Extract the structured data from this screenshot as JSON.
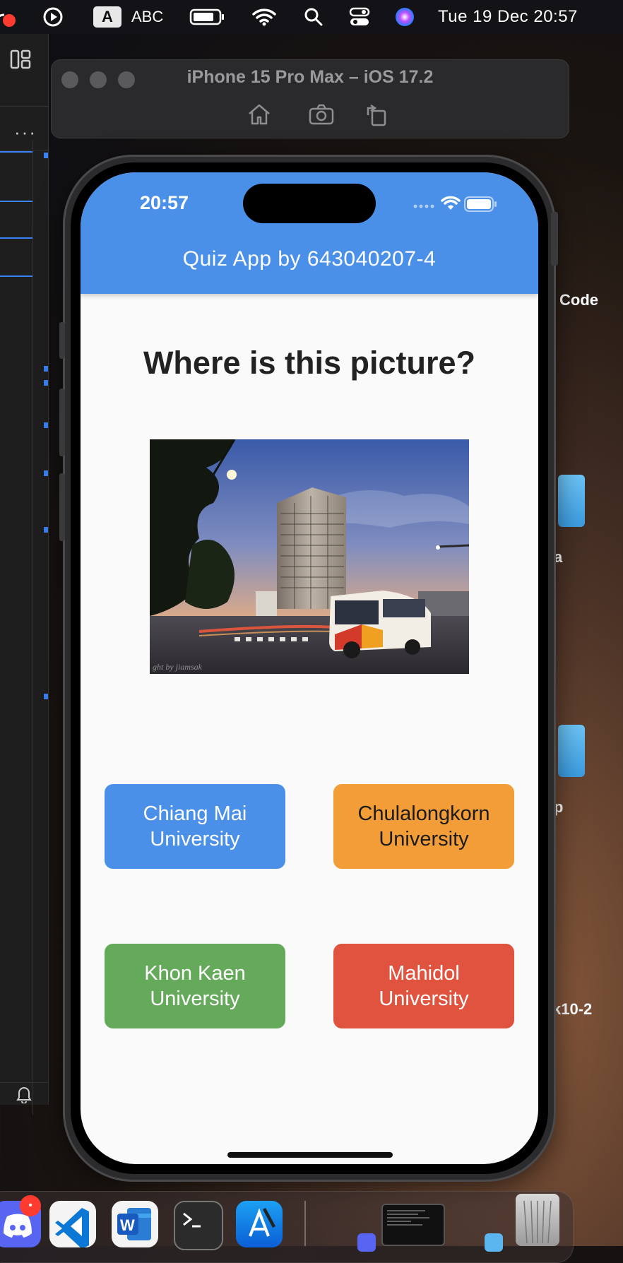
{
  "menubar": {
    "input_source_letter": "A",
    "input_source_name": "ABC",
    "datetime": "Tue 19 Dec  20:57"
  },
  "simulator": {
    "title": "iPhone 15 Pro Max – iOS 17.2",
    "toolbar": [
      "home-icon",
      "screenshot-icon",
      "rotate-icon"
    ]
  },
  "desktop": {
    "labels": [
      "Code",
      "a",
      "p",
      "k10-2"
    ]
  },
  "phone": {
    "status_time": "20:57",
    "app_title": "Quiz App by 643040207-4",
    "question": "Where is this picture?",
    "photo_caption": "ght by jiamsak",
    "answers": [
      {
        "line1": "Chiang Mai",
        "line2": "University",
        "color": "#4a90e8",
        "text_color": "#ffffff"
      },
      {
        "line1": "Chulalongkorn",
        "line2": "University",
        "color": "#f29d38",
        "text_color": "#1c1c1c"
      },
      {
        "line1": "Khon Kaen",
        "line2": "University",
        "color": "#65aa5a",
        "text_color": "#ffffff"
      },
      {
        "line1": "Mahidol",
        "line2": "University",
        "color": "#e0533f",
        "text_color": "#ffffff"
      }
    ]
  },
  "dock": {
    "apps": [
      "discord-icon",
      "vscode-icon",
      "word-icon",
      "terminal-icon",
      "xcode-icon",
      "window-thumbnail",
      "finder-icon",
      "trash-icon"
    ],
    "discord_badge": "•"
  },
  "colors": {
    "appbar": "#4a90e8",
    "screen_bg": "#fafafa",
    "question_text": "#222222"
  }
}
